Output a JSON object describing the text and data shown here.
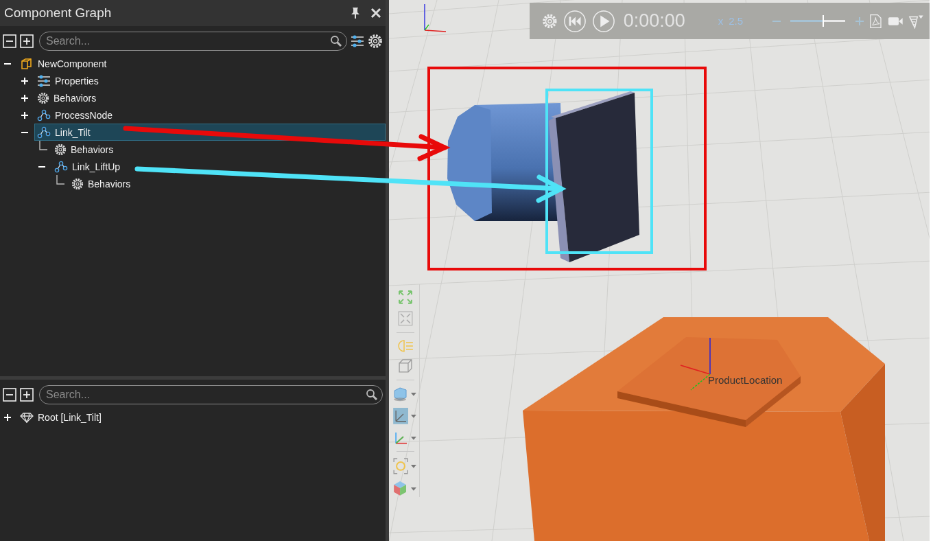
{
  "panel": {
    "title": "Component Graph"
  },
  "graph_search": {
    "placeholder": "Search..."
  },
  "tree": [
    {
      "label": "NewComponent",
      "kind": "component",
      "expanded": true,
      "selected": false,
      "children": [
        {
          "label": "Properties",
          "kind": "properties",
          "expanded": false,
          "selected": false
        },
        {
          "label": "Behaviors",
          "kind": "behaviors",
          "expanded": false,
          "selected": false
        },
        {
          "label": "ProcessNode",
          "kind": "link",
          "expanded": false,
          "selected": false
        },
        {
          "label": "Link_Tilt",
          "kind": "link",
          "expanded": true,
          "selected": true,
          "children": [
            {
              "label": "Behaviors",
              "kind": "behaviors",
              "selected": false
            },
            {
              "label": "Link_LiftUp",
              "kind": "link",
              "expanded": true,
              "selected": false,
              "children": [
                {
                  "label": "Behaviors",
                  "kind": "behaviors",
                  "selected": false
                }
              ]
            }
          ]
        }
      ]
    }
  ],
  "node_search": {
    "placeholder": "Search..."
  },
  "node_tree": [
    {
      "label": "Root [Link_Tilt]",
      "kind": "root",
      "expanded": false,
      "selected": false
    }
  ],
  "playback": {
    "time": "0:00:00",
    "speed_prefix": "x",
    "speed": "2.5",
    "slider": {
      "level": 0.6
    }
  },
  "viewport": {
    "frame_label": "ProductLocation"
  },
  "annotations": [
    {
      "color": "#e80a0a"
    },
    {
      "color": "#4fe3f7"
    }
  ]
}
